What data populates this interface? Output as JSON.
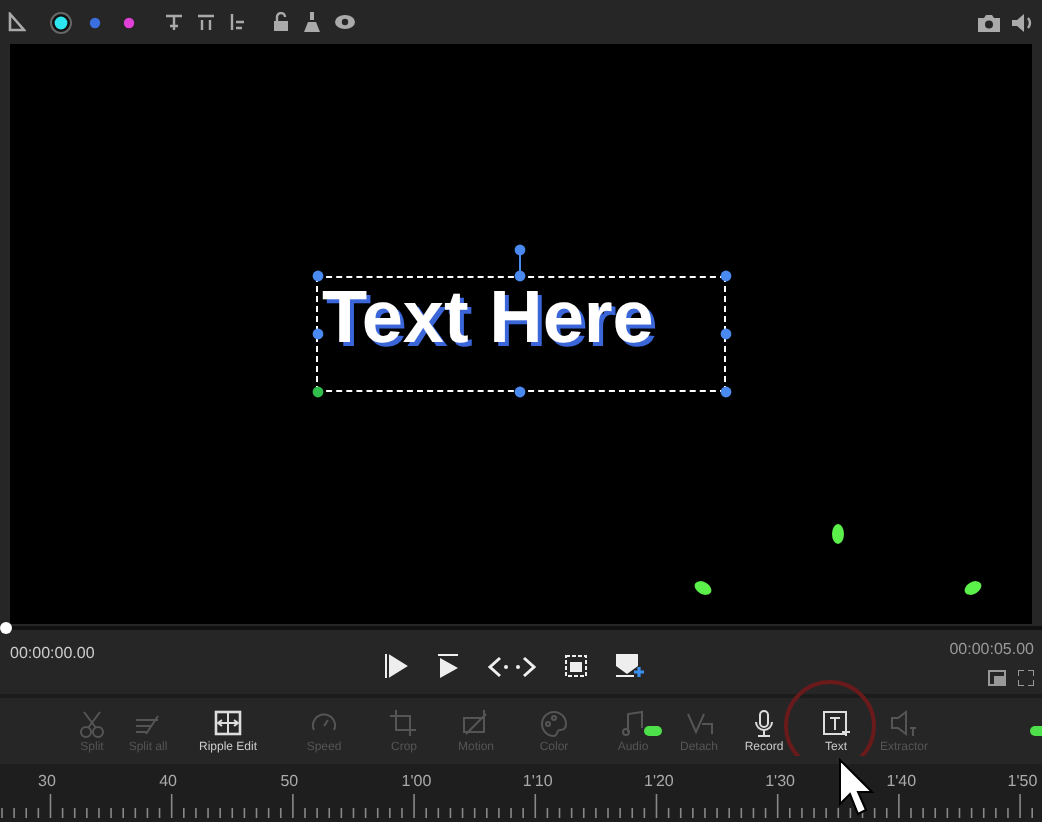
{
  "toolbar": {
    "colors": [
      {
        "color": "#2ee6f0",
        "selected": true
      },
      {
        "color": "#3b6fe0",
        "selected": false
      },
      {
        "color": "#e040d8",
        "selected": false
      }
    ]
  },
  "preview": {
    "text": "Text Here"
  },
  "playback": {
    "level": 0,
    "current_time": "00:00:00.00",
    "total_time": "00:00:05.00"
  },
  "tools": [
    {
      "label": "Split",
      "disabled": true
    },
    {
      "label": "Split all",
      "disabled": true
    },
    {
      "label": "Ripple Edit",
      "disabled": false
    },
    {
      "label": "Speed",
      "disabled": true
    },
    {
      "label": "Crop",
      "disabled": true
    },
    {
      "label": "Motion",
      "disabled": true
    },
    {
      "label": "Color",
      "disabled": true
    },
    {
      "label": "Audio",
      "disabled": true
    },
    {
      "label": "Detach",
      "disabled": true
    },
    {
      "label": "Record",
      "disabled": false
    },
    {
      "label": "Text",
      "disabled": false
    },
    {
      "label": "Extractor",
      "disabled": true
    }
  ],
  "ruler": [
    "30",
    "40",
    "50",
    "1'00",
    "1'10",
    "1'20",
    "1'30",
    "1'40",
    "1'50"
  ]
}
